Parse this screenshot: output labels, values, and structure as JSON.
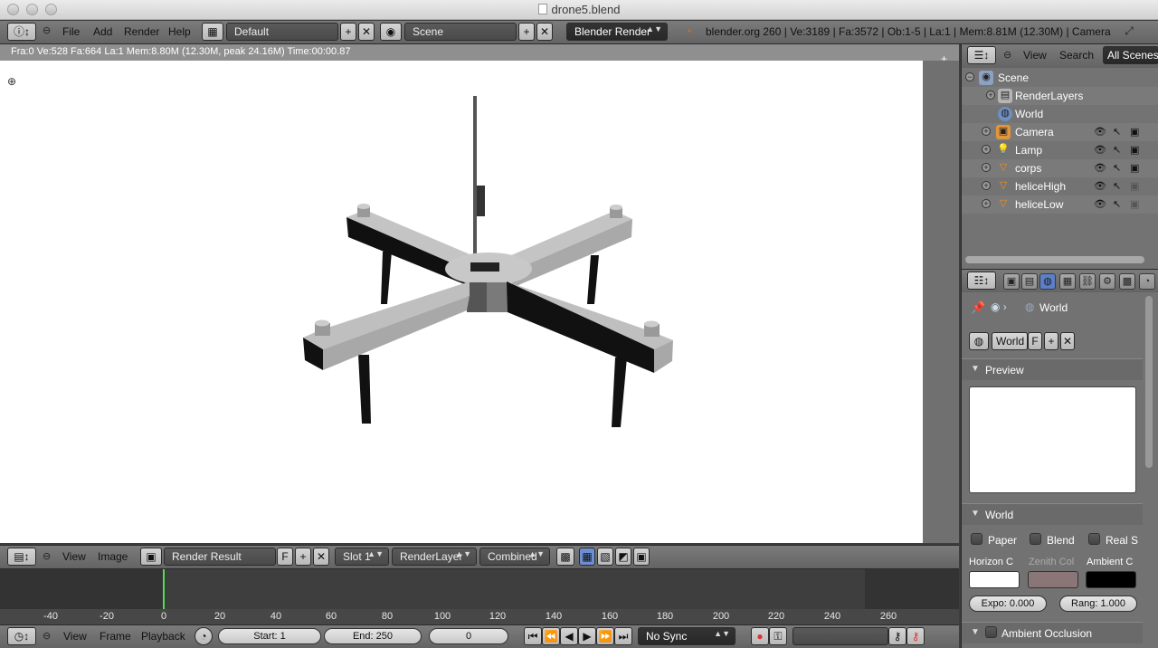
{
  "window": {
    "title": "drone5.blend"
  },
  "topbar": {
    "menus": [
      "File",
      "Add",
      "Render",
      "Help"
    ],
    "layout": "Default",
    "scene": "Scene",
    "engine": "Blender Render",
    "info": "blender.org 260 | Ve:3189 | Fa:3572 | Ob:1-5 | La:1 | Mem:8.81M (12.30M) | Camera"
  },
  "viewport": {
    "status": "Fra:0  Ve:528 Fa:664 La:1 Mem:8.80M (12.30M, peak 24.16M) Time:00:00.87"
  },
  "image_editor": {
    "menus": [
      "View",
      "Image"
    ],
    "image": "Render Result",
    "fake_user": "F",
    "slot": "Slot 1",
    "layer": "RenderLayer",
    "pass": "Combined"
  },
  "timeline": {
    "ticks": [
      "-40",
      "-20",
      "0",
      "20",
      "40",
      "60",
      "80",
      "100",
      "120",
      "140",
      "160",
      "180",
      "200",
      "220",
      "240",
      "260"
    ],
    "current_frame": 0
  },
  "timeline_bar": {
    "menus": [
      "View",
      "Frame",
      "Playback"
    ],
    "start": "Start: 1",
    "end": "End: 250",
    "frame": "0",
    "sync": "No Sync"
  },
  "outliner": {
    "menus": [
      "View",
      "Search"
    ],
    "filter": "All Scenes",
    "rows": [
      {
        "label": "Scene",
        "icon": "scene-icon"
      },
      {
        "label": "RenderLayers",
        "icon": "renderlayers-icon"
      },
      {
        "label": "World",
        "icon": "world-icon"
      },
      {
        "label": "Camera",
        "icon": "camera-icon"
      },
      {
        "label": "Lamp",
        "icon": "lamp-icon"
      },
      {
        "label": "corps",
        "icon": "mesh-icon"
      },
      {
        "label": "heliceHigh",
        "icon": "mesh-icon"
      },
      {
        "label": "heliceLow",
        "icon": "mesh-icon"
      }
    ]
  },
  "properties": {
    "breadcrumb": "World",
    "world_name": "World",
    "fake_user": "F",
    "panels": {
      "preview": "Preview",
      "world": "World",
      "ambient_occlusion": "Ambient Occlusion"
    },
    "checks": [
      "Paper",
      "Blend",
      "Real S"
    ],
    "colors": {
      "horizon_label": "Horizon C",
      "zenith_label": "Zenith Col",
      "ambient_label": "Ambient C",
      "horizon": "#ffffff",
      "zenith": "#8a7676",
      "ambient": "#000000"
    },
    "expo": "Expo: 0.000",
    "range": "Rang: 1.000"
  }
}
